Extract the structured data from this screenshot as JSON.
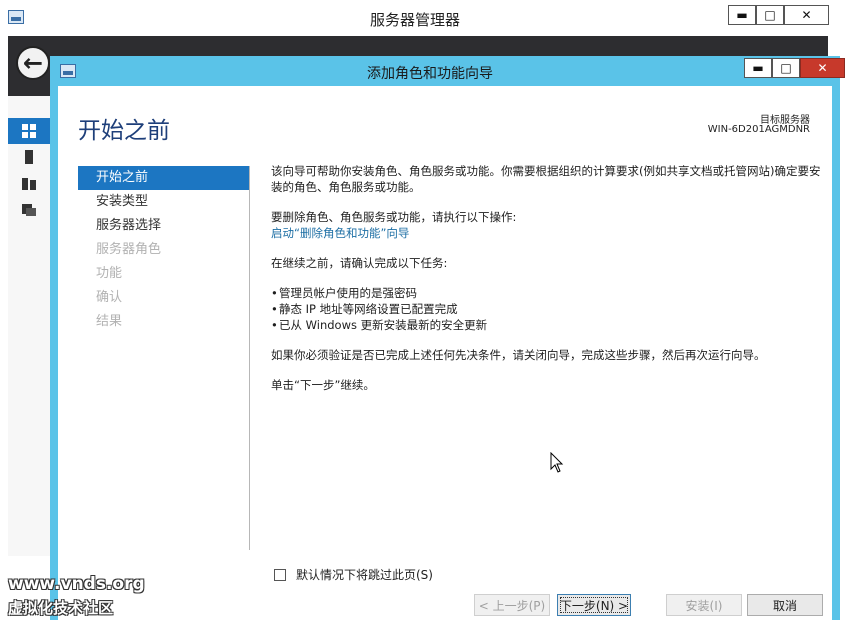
{
  "background_window": {
    "title": "服务器管理器",
    "min_glyph": "▬",
    "max_glyph": "□",
    "close_glyph": "✕",
    "back_glyph": "←"
  },
  "wizard": {
    "title": "添加角色和功能向导",
    "min_glyph": "▬",
    "max_glyph": "□",
    "close_glyph": "✕",
    "page_title": "开始之前",
    "target_server_label": "目标服务器",
    "target_server_name": "WIN-6D201AGMDNR",
    "nav": [
      {
        "label": "开始之前",
        "state": "active"
      },
      {
        "label": "安装类型",
        "state": "enabled"
      },
      {
        "label": "服务器选择",
        "state": "enabled"
      },
      {
        "label": "服务器角色",
        "state": "disabled"
      },
      {
        "label": "功能",
        "state": "disabled"
      },
      {
        "label": "确认",
        "state": "disabled"
      },
      {
        "label": "结果",
        "state": "disabled"
      }
    ],
    "content": {
      "intro": "该向导可帮助你安装角色、角色服务或功能。你需要根据组织的计算要求(例如共享文档或托管网站)确定要安装的角色、角色服务或功能。",
      "remove_text": "要删除角色、角色服务或功能，请执行以下操作:",
      "remove_link": "启动“删除角色和功能”向导",
      "prereq_heading": "在继续之前，请确认完成以下任务:",
      "prereqs": [
        "管理员帐户使用的是强密码",
        "静态 IP 地址等网络设置已配置完成",
        "已从 Windows 更新安装最新的安全更新"
      ],
      "close_note": "如果你必须验证是否已完成上述任何先决条件，请关闭向导，完成这些步骤，然后再次运行向导。",
      "continue_note": "单击“下一步”继续。"
    },
    "skip_checkbox": {
      "label": "默认情况下将跳过此页(S)",
      "checked": false
    },
    "buttons": {
      "previous": "< 上一步(P)",
      "next": "下一步(N) >",
      "install": "安装(I)",
      "cancel": "取消"
    }
  },
  "watermark": {
    "line1": "www.vnds.org",
    "line2": "虚拟化技术社区"
  },
  "colors": {
    "accent": "#1c76c2",
    "dialog_frame": "#5ac3e8",
    "title_text": "#1e3f7a",
    "link": "#1c6ea4"
  }
}
